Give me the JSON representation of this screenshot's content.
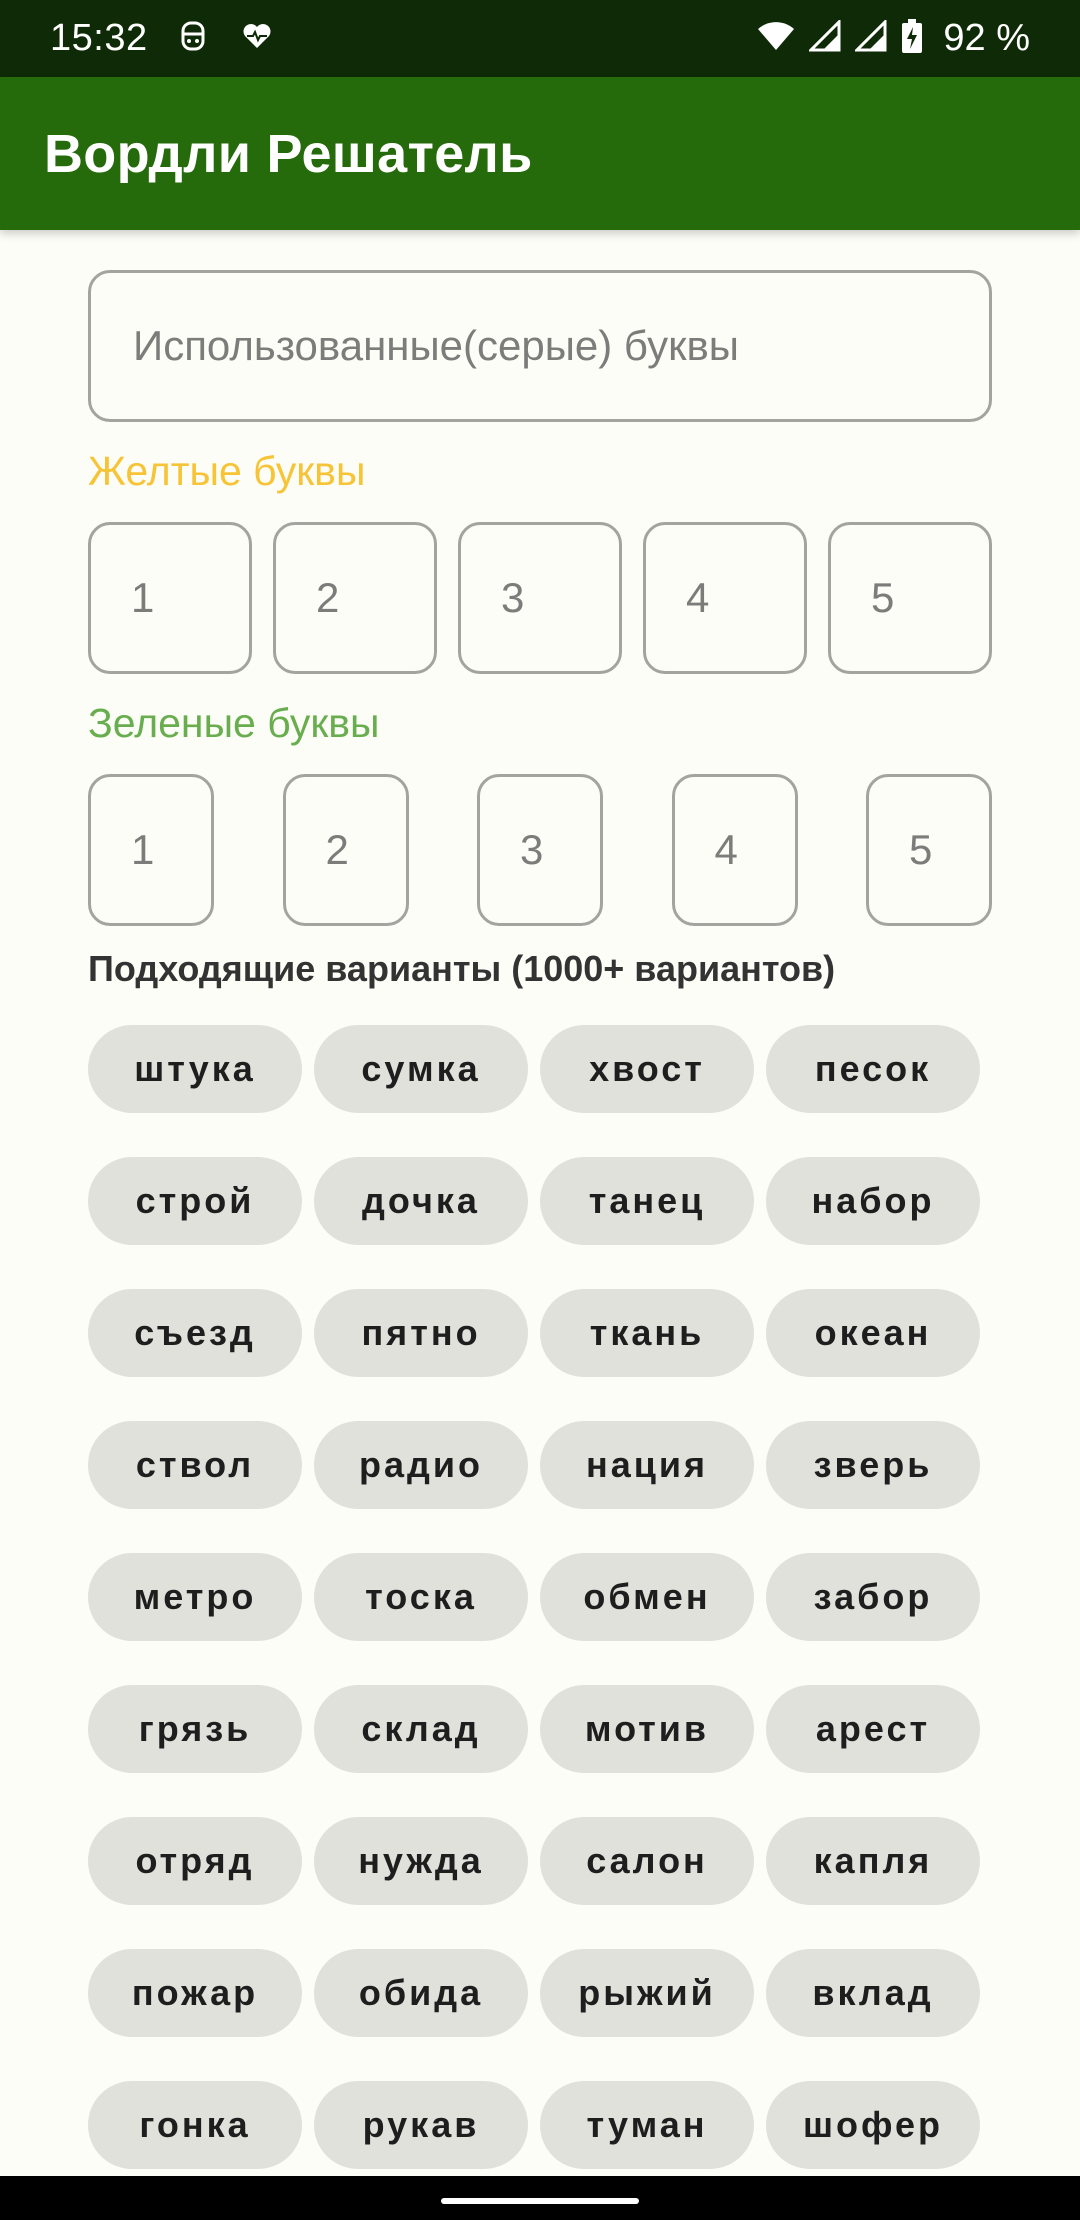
{
  "status_bar": {
    "time": "15:32",
    "left_icons": [
      "face-icon",
      "heart-icon"
    ],
    "right_icons": [
      "wifi-icon",
      "signal-icon",
      "signal-icon",
      "battery-charging-icon"
    ],
    "battery": "92 %"
  },
  "app_bar": {
    "title": "Вордли Решатель",
    "color": "#256A0B"
  },
  "gray_letters": {
    "placeholder": "Использованные(серые) буквы",
    "value": ""
  },
  "yellow": {
    "label": "Желтые буквы",
    "color": "#F6C436",
    "slots": [
      "1",
      "2",
      "3",
      "4",
      "5"
    ]
  },
  "green": {
    "label": "Зеленые буквы",
    "color": "#69AE4E",
    "slots": [
      "1",
      "2",
      "3",
      "4",
      "5"
    ]
  },
  "results": {
    "title": "Подходящие варианты (1000+ вариантов)",
    "words": [
      "штука",
      "сумка",
      "хвост",
      "песок",
      "строй",
      "дочка",
      "танец",
      "набор",
      "съезд",
      "пятно",
      "ткань",
      "океан",
      "ствол",
      "радио",
      "нация",
      "зверь",
      "метро",
      "тоска",
      "обмен",
      "забор",
      "грязь",
      "склад",
      "мотив",
      "арест",
      "отряд",
      "нужда",
      "салон",
      "капля",
      "пожар",
      "обида",
      "рыжий",
      "вклад",
      "гонка",
      "рукав",
      "туман",
      "шофер"
    ]
  }
}
